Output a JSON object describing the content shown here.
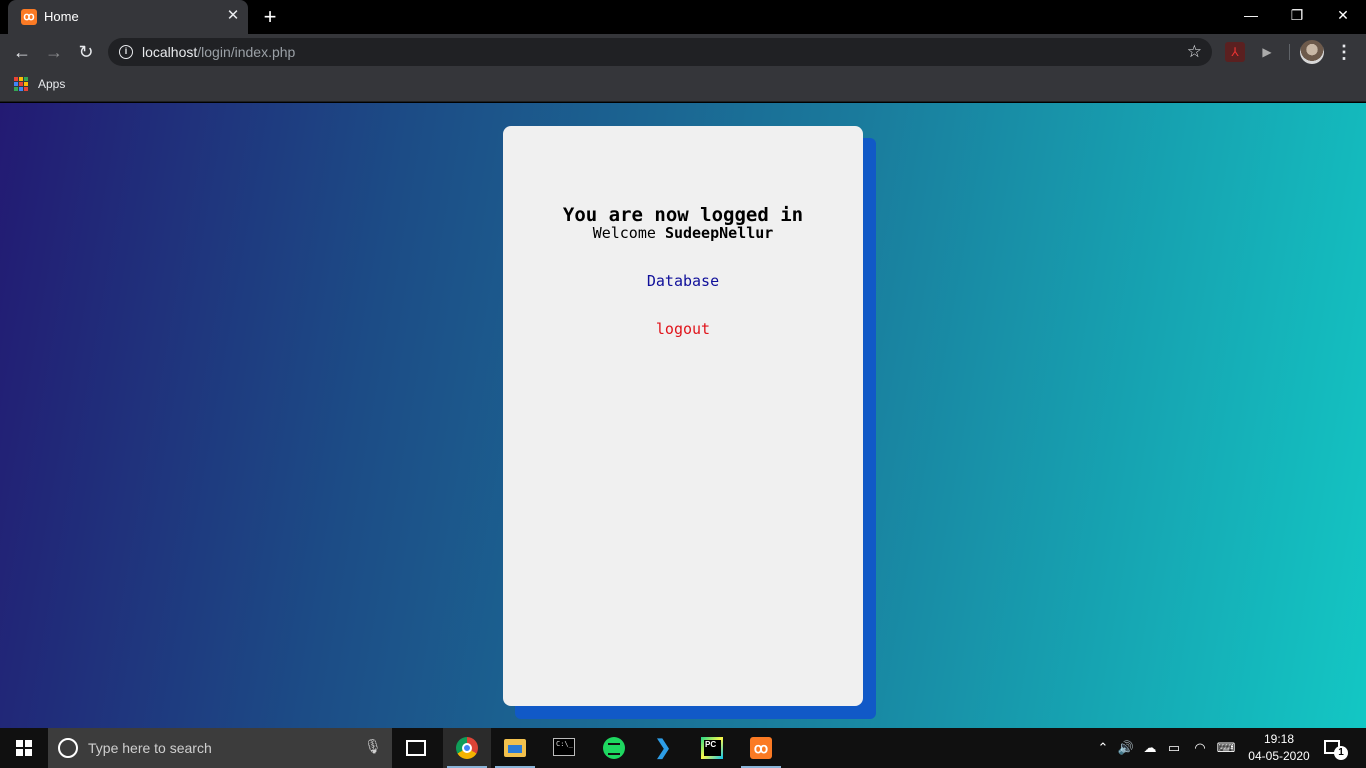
{
  "browser": {
    "tab": {
      "title": "Home",
      "favicon": "xampp-icon"
    },
    "window_controls": {
      "minimize": "—",
      "restore": "❐",
      "close": "✕"
    },
    "nav": {
      "back": "←",
      "forward": "→",
      "reload": "↻"
    },
    "omnibox": {
      "host": "localhost",
      "path": "/login/index.php"
    },
    "bookmarks_bar": {
      "apps_label": "Apps"
    }
  },
  "page": {
    "heading": "You are now logged in",
    "welcome_prefix": "Welcome",
    "username": "SudeepNellur",
    "database_link": "Database",
    "logout_link": "logout",
    "colors": {
      "gradient_start": "#231a73",
      "gradient_end": "#13c7c4",
      "card_bg": "#f0f0f0",
      "card_shadow": "#1159c7",
      "database_link": "#10109a",
      "logout_link": "#e0141b"
    }
  },
  "taskbar": {
    "search_placeholder": "Type here to search",
    "pinned": [
      "task-view",
      "chrome",
      "file-explorer",
      "command-prompt",
      "spotify",
      "vscode",
      "pycharm",
      "xampp"
    ],
    "clock": {
      "time": "19:18",
      "date": "04-05-2020"
    },
    "notification_count": "1"
  }
}
